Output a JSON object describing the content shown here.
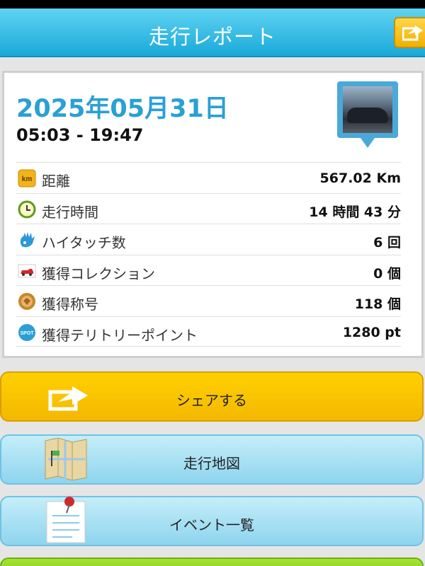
{
  "header": {
    "title": "走行レポート",
    "share_icon": "share-icon"
  },
  "report": {
    "date": "2025年05月31日",
    "time_range": "05:03 - 19:47",
    "car_photo": "car-photo-pin",
    "stats": [
      {
        "icon": "km-icon",
        "label": "距離",
        "value": "567.02 Km"
      },
      {
        "icon": "clock-icon",
        "label": "走行時間",
        "value": "14 時間 43 分"
      },
      {
        "icon": "high-five-icon",
        "label": "ハイタッチ数",
        "value": "6 回"
      },
      {
        "icon": "car-icon",
        "label": "獲得コレクション",
        "value": "0 個"
      },
      {
        "icon": "medal-icon",
        "label": "獲得称号",
        "value": "118 個"
      },
      {
        "icon": "spot-icon",
        "label": "獲得テリトリーポイント",
        "value": "1280 pt"
      }
    ],
    "km_badge": "km",
    "spot_badge": "SPOT"
  },
  "buttons": {
    "share": "シェアする",
    "map": "走行地図",
    "events": "イベント一覧"
  },
  "colors": {
    "header": "#1aa9d9",
    "date": "#2aa0d4",
    "share_button": "#ffd000",
    "blue_button": "#8ed4ee",
    "green_button": "#8ed424"
  }
}
